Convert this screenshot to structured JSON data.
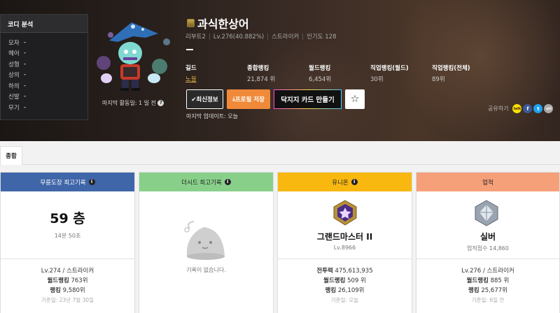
{
  "coordi": {
    "title": "코디 분석",
    "items": [
      {
        "label": "모자",
        "value": "-"
      },
      {
        "label": "헤어",
        "value": "-"
      },
      {
        "label": "성형",
        "value": "-"
      },
      {
        "label": "상의",
        "value": "-"
      },
      {
        "label": "하의",
        "value": "-"
      },
      {
        "label": "신발",
        "value": "-"
      },
      {
        "label": "무기",
        "value": "-"
      }
    ]
  },
  "character": {
    "name": "과식한상어",
    "world": "리부트2",
    "level": "Lv.276(40.882%)",
    "job": "스트라이커",
    "popularity": "인기도 128",
    "last_active": "마지막 활동일: 1 일 전"
  },
  "stats": [
    {
      "label": "길드",
      "value": "노블"
    },
    {
      "label": "종합랭킹",
      "value": "21,874 위"
    },
    {
      "label": "월드랭킹",
      "value": "6,454위"
    },
    {
      "label": "직업랭킹(월드)",
      "value": "30위"
    },
    {
      "label": "직업랭킹(전체)",
      "value": "89위"
    }
  ],
  "buttons": {
    "refresh": "✔최신정보",
    "save": "프로필 저장",
    "card": "닥지지 카드 만들기",
    "star": "☆"
  },
  "updated": "마지막 업데이트: 오늘",
  "share": {
    "label": "공유하기",
    "kakao": "talk",
    "fb": "f",
    "tw": "t",
    "link": "url"
  },
  "tabs": [
    "종합"
  ],
  "cards": {
    "mureung": {
      "title": "무릉도장 최고기록",
      "color": "#3f66a8",
      "floor": "59 층",
      "time": "14분 50초",
      "level_job": "Lv.274 / 스트라이커",
      "world_rank_label": "월드랭킹",
      "world_rank": "763위",
      "rank_label": "랭킹",
      "rank": "9,580위",
      "date": "기준일: 23년 7월 30일"
    },
    "theseed": {
      "title": "더시드 최고기록",
      "color": "#88d08a",
      "empty": "기록이 없습니다."
    },
    "union": {
      "title": "유니온",
      "color": "#f8b810",
      "grade": "그랜드마스터 II",
      "level": "Lv.8966",
      "power_label": "전투력",
      "power": "475,613,935",
      "world_rank_label": "월드랭킹",
      "world_rank": "509 위",
      "rank_label": "랭킹",
      "rank": "26,109위",
      "date": "기준일: 오늘"
    },
    "achieve": {
      "title": "업적",
      "color": "#f6a07a",
      "grade": "실버",
      "score": "업적점수 14,860",
      "level_job": "Lv.276 / 스트라이커",
      "world_rank_label": "월드랭킹",
      "world_rank": "885 위",
      "rank_label": "랭킹",
      "rank": "25,677위",
      "date": "기준일: 6일 전"
    }
  }
}
